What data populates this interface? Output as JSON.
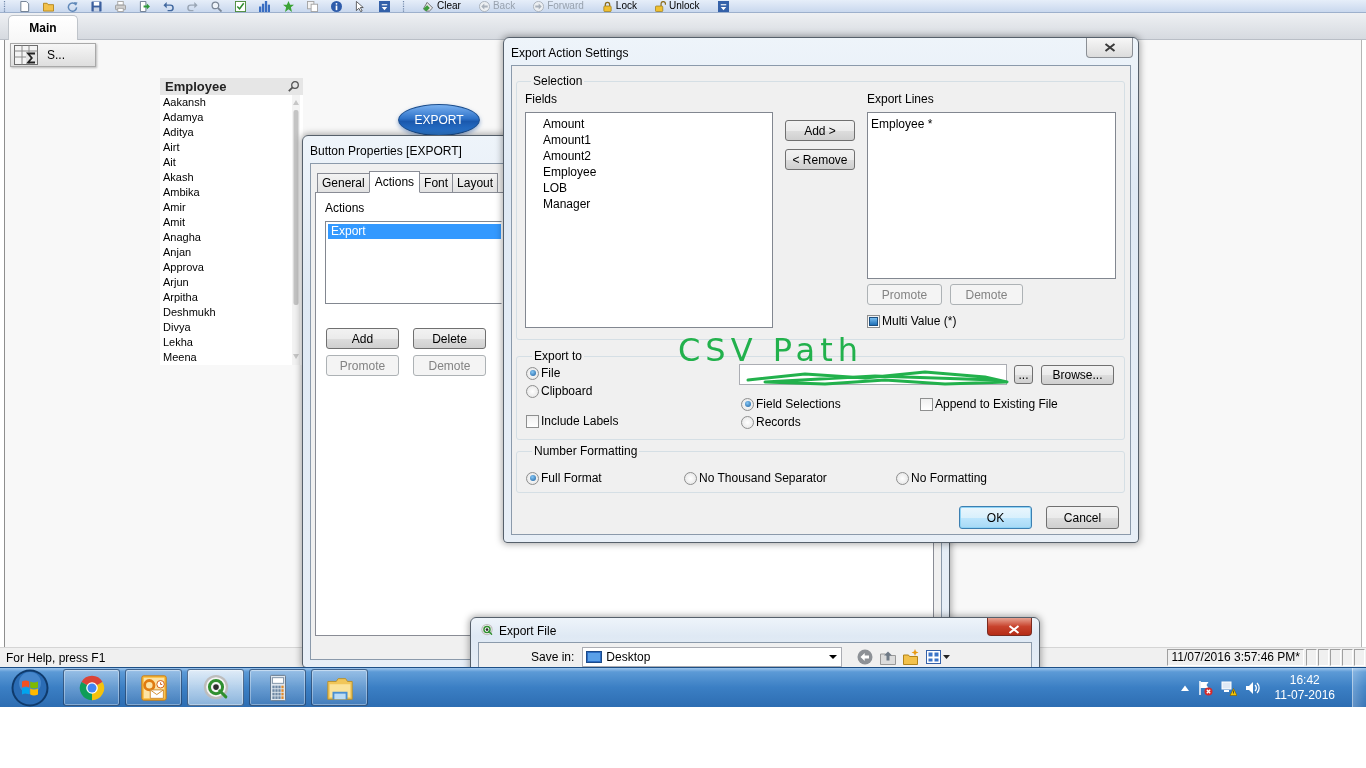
{
  "toolbar": {
    "buttons": [
      {
        "label": "Clear",
        "disabled": false
      },
      {
        "label": "Back",
        "disabled": true
      },
      {
        "label": "Forward",
        "disabled": true
      },
      {
        "label": "Lock",
        "disabled": false
      },
      {
        "label": "Unlock",
        "disabled": false
      }
    ]
  },
  "tabs": [
    {
      "label": "Main",
      "selected": true
    }
  ],
  "sheet": {
    "minimized_object": {
      "caption": "S..."
    },
    "listbox": {
      "title": "Employee",
      "items": [
        "Aakansh",
        "Adamya",
        "Aditya",
        "Airt",
        "Ait",
        "Akash",
        "Ambika",
        "Amir",
        "Amit",
        "Anagha",
        "Anjan",
        "Approva",
        "Arjun",
        "Arpitha",
        "Deshmukh",
        "Divya",
        "Lekha",
        "Meena"
      ]
    },
    "button": {
      "label": "EXPORT"
    }
  },
  "button_properties": {
    "title": "Button Properties [EXPORT]",
    "tabs": [
      {
        "label": "General",
        "selected": false
      },
      {
        "label": "Actions",
        "selected": true
      },
      {
        "label": "Font",
        "selected": false
      },
      {
        "label": "Layout",
        "selected": false
      }
    ],
    "actions_label": "Actions",
    "actions": [
      {
        "label": "Export",
        "selected": true
      }
    ],
    "buttons": [
      {
        "label": "Add",
        "disabled": false
      },
      {
        "label": "Delete",
        "disabled": false
      },
      {
        "label": "Promote",
        "disabled": true
      },
      {
        "label": "Demote",
        "disabled": true
      }
    ]
  },
  "export_action_settings": {
    "title": "Export Action Settings",
    "selection": {
      "label": "Selection",
      "fields_label": "Fields",
      "fields": [
        "Amount",
        "Amount1",
        "Amount2",
        "Employee",
        "LOB",
        "Manager"
      ],
      "add_label": "Add >",
      "remove_label": "< Remove",
      "export_lines_label": "Export Lines",
      "export_lines": [
        "Employee *"
      ],
      "line_buttons": [
        {
          "label": "Promote",
          "disabled": true
        },
        {
          "label": "Demote",
          "disabled": true
        }
      ],
      "multi_value": {
        "label": "Multi Value (*)",
        "checked": true
      }
    },
    "export_to": {
      "label": "Export to",
      "targets": [
        {
          "label": "File",
          "selected": true
        },
        {
          "label": "Clipboard",
          "selected": false
        }
      ],
      "include_labels": {
        "label": "Include Labels",
        "checked": false
      },
      "path_button": "...",
      "browse_button": "Browse...",
      "modes": [
        {
          "label": "Field Selections",
          "selected": true
        },
        {
          "label": "Records",
          "selected": false
        }
      ],
      "append": {
        "label": "Append to Existing File",
        "checked": false
      }
    },
    "number_formatting": {
      "label": "Number Formatting",
      "options": [
        {
          "label": "Full Format",
          "selected": true
        },
        {
          "label": "No Thousand Separator",
          "selected": false
        },
        {
          "label": "No Formatting",
          "selected": false
        }
      ]
    },
    "buttons": [
      {
        "label": "OK",
        "default": true
      },
      {
        "label": "Cancel",
        "default": false
      }
    ]
  },
  "annotation": {
    "text": "CSV Path"
  },
  "export_file": {
    "title": "Export File",
    "save_in_label": "Save in:",
    "location": "Desktop"
  },
  "status_bar": {
    "help": "For Help, press F1",
    "timestamp": "11/07/2016 3:57:46 PM*"
  },
  "taskbar": {
    "apps": [
      {
        "kind": "browser",
        "active": false
      },
      {
        "kind": "mail",
        "active": false
      },
      {
        "kind": "analytics",
        "active": true
      },
      {
        "kind": "calculator",
        "active": false
      },
      {
        "kind": "folder",
        "active": false
      }
    ],
    "clock": {
      "time": "16:42",
      "date": "11-07-2016"
    }
  }
}
